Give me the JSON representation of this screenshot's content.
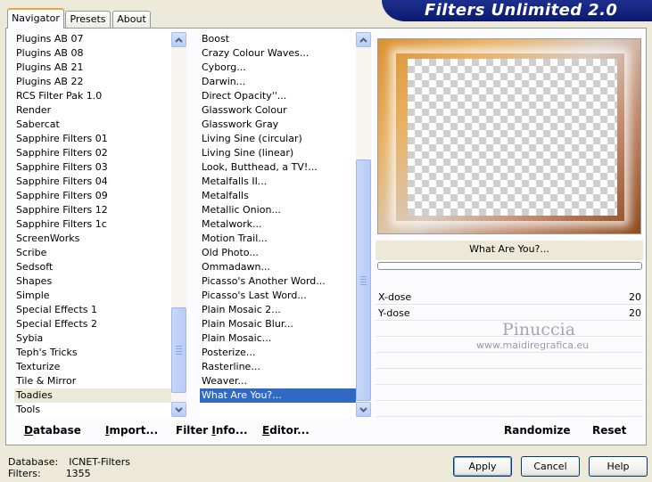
{
  "tabs": [
    {
      "label": "Navigator",
      "active": true
    },
    {
      "label": "Presets",
      "active": false
    },
    {
      "label": "About",
      "active": false
    }
  ],
  "app_title": "Filters Unlimited 2.0",
  "categories": {
    "items": [
      "Plugins AB 07",
      "Plugins AB 08",
      "Plugins AB 21",
      "Plugins AB 22",
      "RCS Filter Pak 1.0",
      "Render",
      "Sabercat",
      "Sapphire Filters 01",
      "Sapphire Filters 02",
      "Sapphire Filters 03",
      "Sapphire Filters 04",
      "Sapphire Filters 09",
      "Sapphire Filters 12",
      "Sapphire Filters 1c",
      "ScreenWorks",
      "Scribe",
      "Sedsoft",
      "Shapes",
      "Simple",
      "Special Effects 1",
      "Special Effects 2",
      "Sybia",
      "Teph's Tricks",
      "Texturize",
      "Tile & Mirror",
      "Toadies",
      "Tools"
    ],
    "selected": "Toadies"
  },
  "filters": {
    "items": [
      "Boost",
      "Crazy Colour Waves...",
      "Cyborg...",
      "Darwin...",
      "Direct Opacity''...",
      "Glasswork Colour",
      "Glasswork Gray",
      "Living Sine (circular)",
      "Living Sine (linear)",
      "Look, Butthead, a TV!...",
      "Metalfalls II...",
      "Metalfalls",
      "Metallic Onion...",
      "Metalwork...",
      "Motion Trail...",
      "Old Photo...",
      "Ommadawn...",
      "Picasso's Another Word...",
      "Picasso's Last Word...",
      "Plain Mosaic 2...",
      "Plain Mosaic Blur...",
      "Plain Mosaic...",
      "Posterize...",
      "Rasterline...",
      "Weaver...",
      "What Are You?..."
    ],
    "selected": "What Are You?..."
  },
  "filter_name": "What Are You?...",
  "params": [
    {
      "label": "X-dose",
      "value": "20"
    },
    {
      "label": "Y-dose",
      "value": "20"
    }
  ],
  "watermark": {
    "name": "Pinuccia",
    "url": "www.maidiregrafica.eu"
  },
  "links": {
    "database": {
      "underlined": "D",
      "rest": "atabase"
    },
    "import": {
      "pre": "",
      "underlined": "I",
      "rest": "mport..."
    },
    "filter_info": {
      "pre": "Filter ",
      "underlined": "I",
      "rest": "nfo..."
    },
    "editor": {
      "pre": "",
      "underlined": "E",
      "rest": "ditor..."
    },
    "randomize": "Randomize",
    "reset": "Reset"
  },
  "status": {
    "database_label": "Database:",
    "database_value": "ICNET-Filters",
    "filters_label": "Filters:",
    "filters_value": "1355"
  },
  "buttons": {
    "apply": "Apply",
    "cancel": "Cancel",
    "help": "Help"
  },
  "colors": {
    "selection": "#316ac5",
    "banner": "#0b1a6e",
    "tab_highlight": "#e8a53a"
  }
}
